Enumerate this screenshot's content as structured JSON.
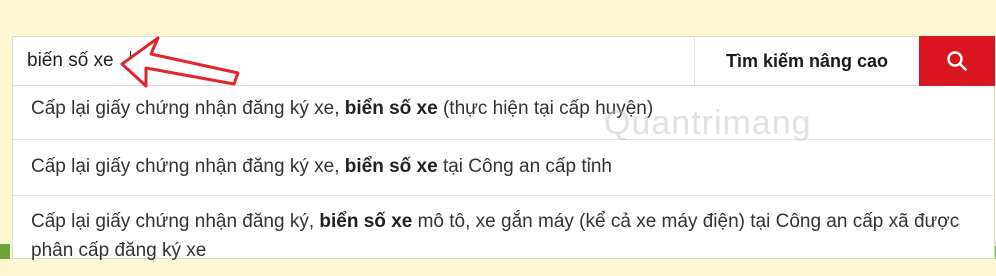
{
  "search": {
    "value": "biến số xe",
    "advanced_label": "Tìm kiếm nâng cao"
  },
  "suggestions": [
    {
      "prefix": "Cấp lại giấy chứng nhận đăng ký xe, ",
      "bold": "biển số xe",
      "suffix": " (thực hiện tại cấp huyện)"
    },
    {
      "prefix": "Cấp lại giấy chứng nhận đăng ký xe, ",
      "bold": "biển số xe",
      "suffix": " tại Công an cấp tỉnh"
    },
    {
      "prefix": "Cấp lại giấy chứng nhận đăng ký, ",
      "bold": "biển số xe",
      "suffix": " mô tô, xe gắn máy (kể cả xe máy điện) tại Công an cấp xã được phân cấp đăng ký xe"
    }
  ],
  "watermark": "Quantrimang",
  "icons": {
    "search_button": "search-icon",
    "annotation": "red-arrow-icon"
  },
  "colors": {
    "accent": "#d9161f",
    "annotation": "#e2262b",
    "page_background": "#fdf6d3"
  }
}
